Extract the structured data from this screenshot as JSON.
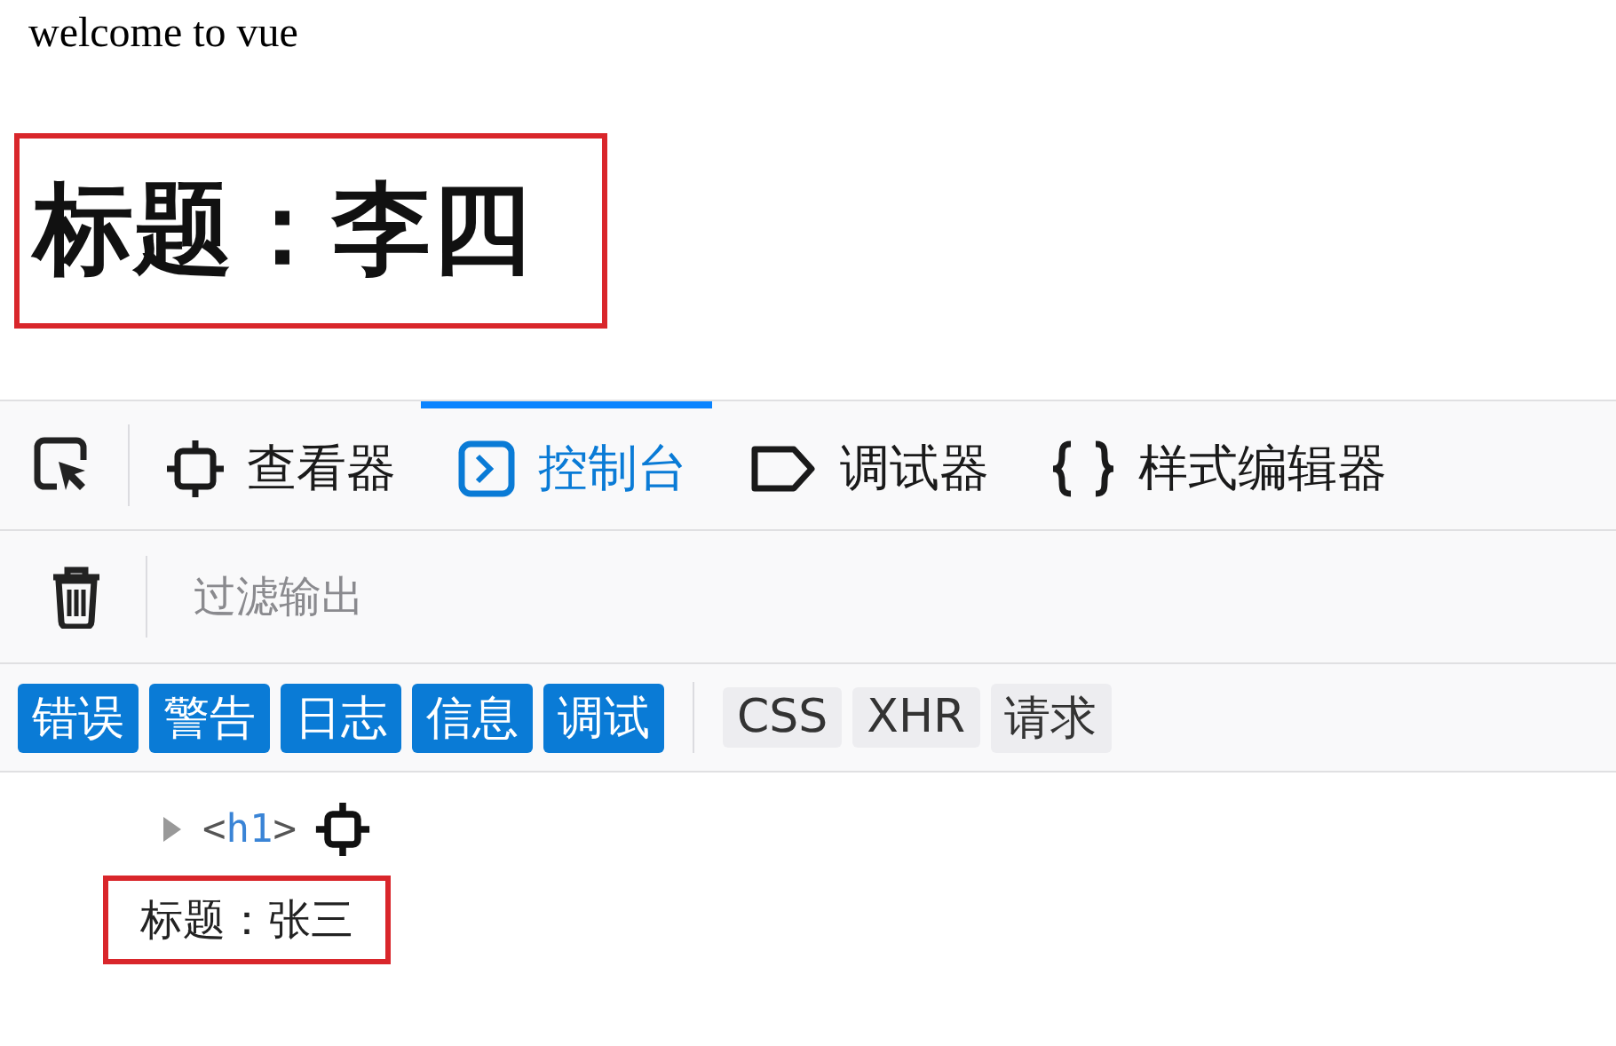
{
  "page": {
    "text": "welcome to vue",
    "heading": "标题：李四",
    "heading_highlighted": true
  },
  "devtools": {
    "tabs": [
      {
        "label": "查看器",
        "kind": "inspector",
        "selected": false
      },
      {
        "label": "控制台",
        "kind": "console",
        "selected": true
      },
      {
        "label": "调试器",
        "kind": "debugger",
        "selected": false
      },
      {
        "label": "样式编辑器",
        "kind": "style",
        "selected": false
      }
    ],
    "filter": {
      "placeholder": "过滤输出"
    },
    "chips": [
      {
        "label": "错误",
        "selected": true
      },
      {
        "label": "警告",
        "selected": true
      },
      {
        "label": "日志",
        "selected": true
      },
      {
        "label": "信息",
        "selected": true
      },
      {
        "label": "调试",
        "selected": true
      },
      {
        "label": "CSS",
        "selected": false
      },
      {
        "label": "XHR",
        "selected": false
      },
      {
        "label": "请求",
        "selected": false
      }
    ],
    "log": {
      "open": "<",
      "name": "h1",
      "close": ">",
      "expanded": false,
      "text": "标题：张三",
      "highlighted": true
    }
  }
}
